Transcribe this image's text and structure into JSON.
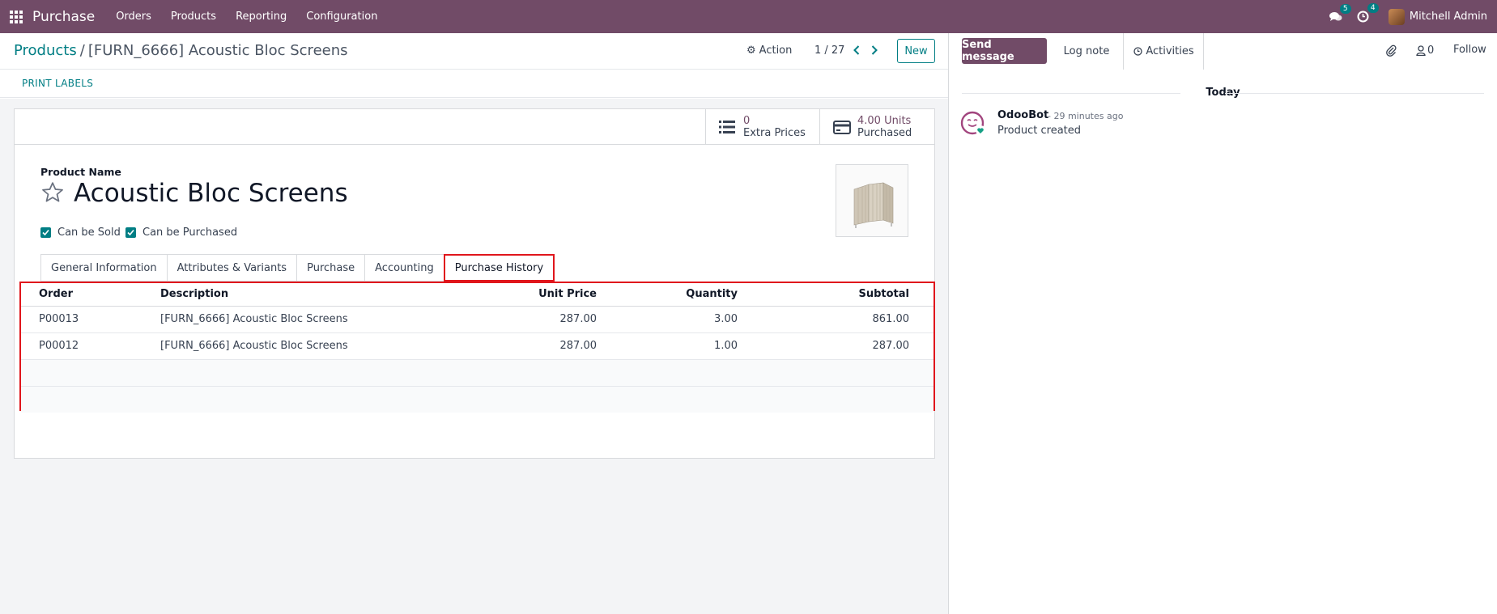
{
  "navbar": {
    "app_name": "Purchase",
    "menu": [
      "Orders",
      "Products",
      "Reporting",
      "Configuration"
    ],
    "messages_count": "5",
    "activities_count": "4",
    "user_name": "Mitchell Admin",
    "color": "#714b67"
  },
  "control": {
    "breadcrumb_parent": "Products",
    "breadcrumb_separator": "/",
    "breadcrumb_current": "[FURN_6666] Acoustic Bloc Screens",
    "action_label": "Action",
    "pager": "1 / 27",
    "new_label": "New"
  },
  "statusbar": {
    "print_labels": "PRINT LABELS"
  },
  "smart_buttons": {
    "extra_prices_value": "0",
    "extra_prices_label": "Extra Prices",
    "purchased_value": "4.00 Units",
    "purchased_label": "Purchased"
  },
  "product": {
    "name_label": "Product Name",
    "name": "Acoustic Bloc Screens",
    "can_be_sold": "Can be Sold",
    "can_be_purchased": "Can be Purchased"
  },
  "tabs": [
    "General Information",
    "Attributes & Variants",
    "Purchase",
    "Accounting",
    "Purchase History"
  ],
  "active_tab": "Purchase History",
  "history": {
    "columns": [
      "Order",
      "Description",
      "Unit Price",
      "Quantity",
      "Subtotal"
    ],
    "rows": [
      {
        "order": "P00013",
        "description": "[FURN_6666] Acoustic Bloc Screens",
        "unit_price": "287.00",
        "quantity": "3.00",
        "subtotal": "861.00"
      },
      {
        "order": "P00012",
        "description": "[FURN_6666] Acoustic Bloc Screens",
        "unit_price": "287.00",
        "quantity": "1.00",
        "subtotal": "287.00"
      }
    ]
  },
  "chatter": {
    "send_message": "Send message",
    "log_note": "Log note",
    "activities": "Activities",
    "followers_count": "0",
    "follow": "Follow",
    "date_separator": "Today",
    "message": {
      "author": "OdooBot",
      "time": "- 29 minutes ago",
      "body": "Product created"
    }
  },
  "colors": {
    "brand": "#714b67",
    "accent": "#017e84",
    "highlight": "#e0161c"
  }
}
